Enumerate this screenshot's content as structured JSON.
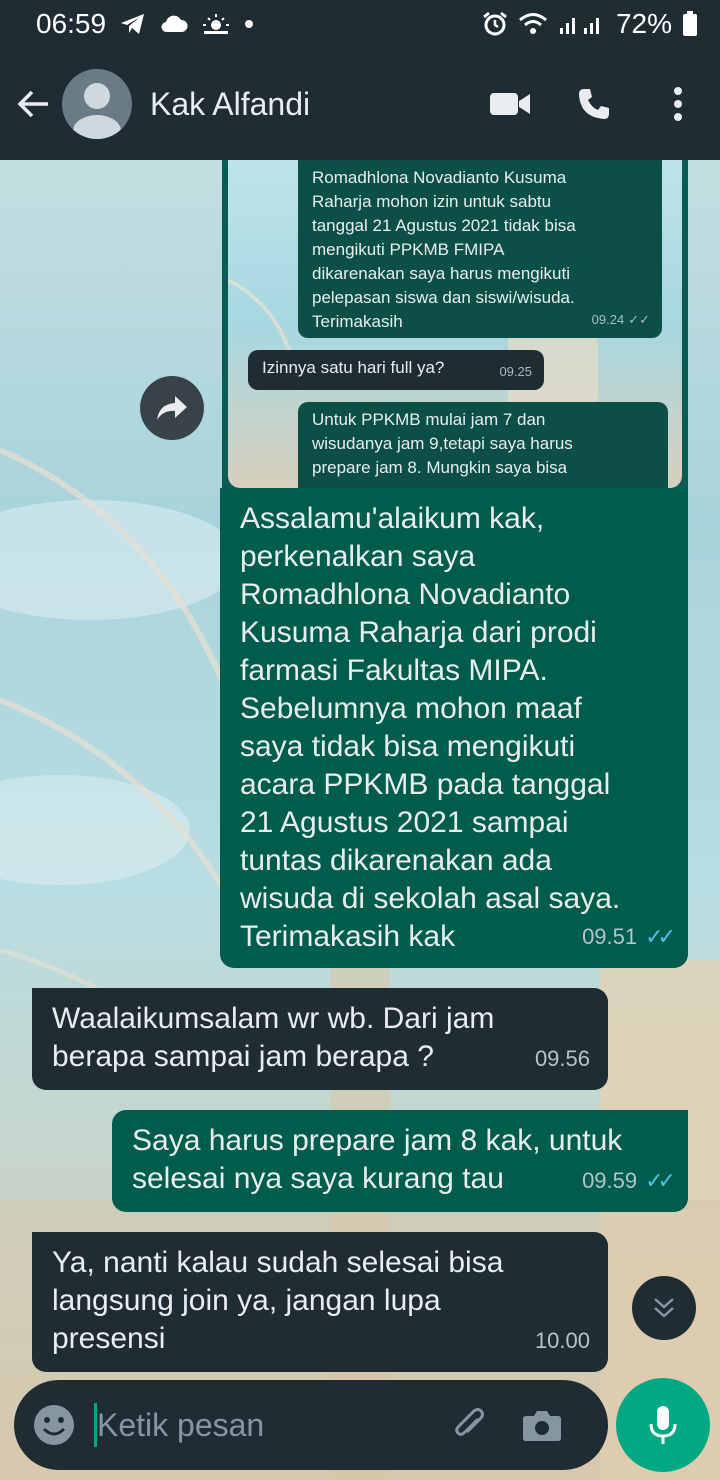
{
  "status_bar": {
    "time": "06:59",
    "battery": "72%",
    "icons": [
      "telegram-icon",
      "cloud-icon",
      "weather-icon",
      "dot-icon",
      "alarm-icon",
      "wifi-icon",
      "signal-icon",
      "battery-icon"
    ]
  },
  "header": {
    "contact_name": "Kak Alfandi",
    "icons": [
      "back-arrow-icon",
      "avatar",
      "video-call-icon",
      "phone-icon",
      "more-vert-icon"
    ]
  },
  "forwarded_screenshot": {
    "messages": [
      {
        "direction": "out",
        "text": "Romadhlona Novadianto Kusuma\nRaharja mohon izin untuk sabtu\ntanggal 21 Agustus 2021 tidak bisa\nmengikuti PPKMB FMIPA\ndikarenakan saya harus mengikuti\npelepasan siswa dan siswi/wisuda.\nTerimakasih",
        "time": "09.24"
      },
      {
        "direction": "in",
        "text": "Izinnya satu hari full ya?",
        "time": "09.25"
      },
      {
        "direction": "out",
        "text": "Untuk PPKMB mulai jam 7 dan\nwisudanya jam 9,tetapi saya harus\nprepare jam 8. Mungkin saya bisa",
        "time": ""
      }
    ]
  },
  "messages": [
    {
      "direction": "out",
      "text": "Assalamu'alaikum kak,\nperkenalkan saya\nRomadhlona Novadianto\nKusuma Raharja dari prodi\nfarmasi Fakultas MIPA.\nSebelumnya mohon maaf\nsaya tidak bisa mengikuti\nacara PPKMB pada tanggal\n21 Agustus 2021 sampai\ntuntas dikarenakan ada\nwisuda di sekolah asal saya.\nTerimakasih kak",
      "time": "09.51",
      "read": true
    },
    {
      "direction": "in",
      "text": "Waalaikumsalam wr wb. Dari jam\nberapa sampai jam berapa ?",
      "time": "09.56"
    },
    {
      "direction": "out",
      "text": "Saya harus prepare jam 8 kak, untuk\nselesai nya saya kurang tau",
      "time": "09.59",
      "read": true
    },
    {
      "direction": "in",
      "text": "Ya, nanti kalau sudah selesai bisa\nlangsung join ya, jangan lupa\npresensi",
      "time": "10.00"
    }
  ],
  "composer": {
    "placeholder": "Ketik pesan",
    "value": "",
    "icons": [
      "emoji-icon",
      "attach-icon",
      "camera-icon",
      "mic-icon"
    ]
  },
  "colors": {
    "header_bg": "#1f2c34",
    "bubble_out": "#005c4b",
    "bubble_in": "#1f2c34",
    "read_tick": "#53bdeb",
    "accent": "#00a884"
  }
}
